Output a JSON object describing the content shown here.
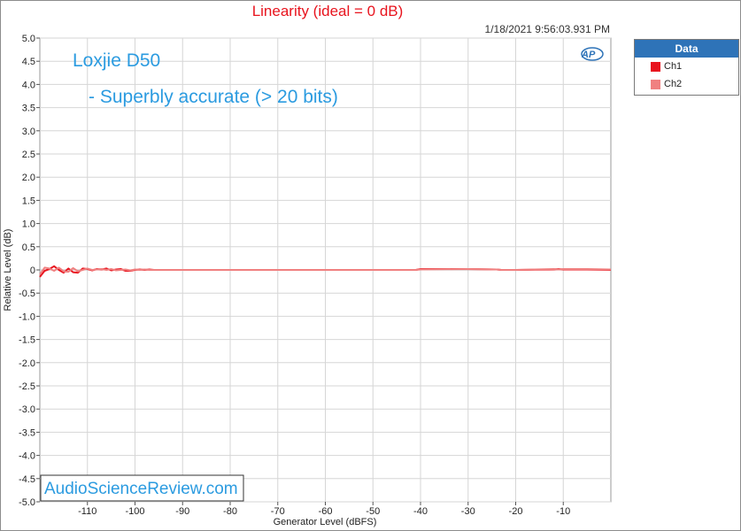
{
  "title": "Linearity (ideal = 0 dB)",
  "timestamp": "1/18/2021 9:56:03.931 PM",
  "annotations": {
    "product": "Loxjie D50",
    "comment": "- Superbly accurate (> 20 bits)",
    "watermark": "AudioScienceReview.com",
    "logo": "AP"
  },
  "legend": {
    "title": "Data",
    "items": [
      {
        "label": "Ch1",
        "color": "#e8141e"
      },
      {
        "label": "Ch2",
        "color": "#f08080"
      }
    ]
  },
  "colors": {
    "accent": "#e8141e",
    "annotation": "#2b9be0",
    "legend_header": "#2e73b8"
  },
  "chart_data": {
    "type": "line",
    "xlabel": "Generator Level (dBFS)",
    "ylabel": "Relative Level (dB)",
    "xlim": [
      -120,
      0
    ],
    "ylim": [
      -5.0,
      5.0
    ],
    "x_ticks": [
      -110,
      -100,
      -90,
      -80,
      -70,
      -60,
      -50,
      -40,
      -30,
      -20,
      -10
    ],
    "y_ticks": [
      "5.0",
      "4.5",
      "4.0",
      "3.5",
      "3.0",
      "2.5",
      "2.0",
      "1.5",
      "1.0",
      "0.5",
      "0",
      "-0.5",
      "-1.0",
      "-1.5",
      "-2.0",
      "-2.5",
      "-3.0",
      "-3.5",
      "-4.0",
      "-4.5",
      "-5.0"
    ],
    "grid": true,
    "series": [
      {
        "name": "Ch1",
        "color": "#e8141e",
        "x": [
          -120,
          -119,
          -118,
          -117,
          -116,
          -115,
          -114,
          -113,
          -112,
          -111,
          -110,
          -109,
          -108,
          -107,
          -106,
          -105,
          -104,
          -103,
          -102,
          -101,
          -100,
          -99,
          -98,
          -97,
          -96,
          -95,
          -90,
          -80,
          -70,
          -60,
          -50,
          -41,
          -40,
          -30,
          -24,
          -23,
          -20,
          -12,
          -11,
          -10,
          -5,
          0
        ],
        "y": [
          -0.15,
          -0.02,
          0.02,
          0.08,
          0.0,
          -0.06,
          0.03,
          -0.05,
          -0.06,
          0.03,
          0.02,
          -0.01,
          0.02,
          0.01,
          0.03,
          -0.01,
          0.01,
          0.02,
          -0.02,
          -0.02,
          0.0,
          0.01,
          0.0,
          0.01,
          0.0,
          0.0,
          0.0,
          0.0,
          0.0,
          0.0,
          0.0,
          0.0,
          0.02,
          0.02,
          0.01,
          0.0,
          0.0,
          0.01,
          0.02,
          0.01,
          0.01,
          0.0
        ]
      },
      {
        "name": "Ch2",
        "color": "#f08080",
        "x": [
          -120,
          -119,
          -118,
          -117,
          -116,
          -115,
          -114,
          -113,
          -112,
          -111,
          -110,
          -109,
          -108,
          -107,
          -106,
          -105,
          -104,
          -103,
          -102,
          -101,
          -100,
          -99,
          -98,
          -97,
          -96,
          -95,
          -90,
          -80,
          -70,
          -60,
          -50,
          -41,
          -40,
          -30,
          -24,
          -23,
          -20,
          -12,
          -11,
          -10,
          -5,
          0
        ],
        "y": [
          -0.1,
          0.05,
          0.03,
          -0.02,
          0.05,
          -0.03,
          -0.04,
          0.04,
          -0.03,
          0.0,
          0.03,
          0.0,
          0.01,
          0.02,
          0.0,
          0.02,
          -0.01,
          0.0,
          0.01,
          -0.01,
          0.01,
          0.0,
          0.01,
          0.0,
          0.0,
          0.0,
          0.0,
          0.0,
          0.0,
          0.0,
          0.0,
          0.0,
          0.01,
          0.02,
          0.01,
          0.0,
          0.0,
          0.02,
          0.01,
          0.02,
          0.02,
          0.01
        ]
      }
    ]
  }
}
